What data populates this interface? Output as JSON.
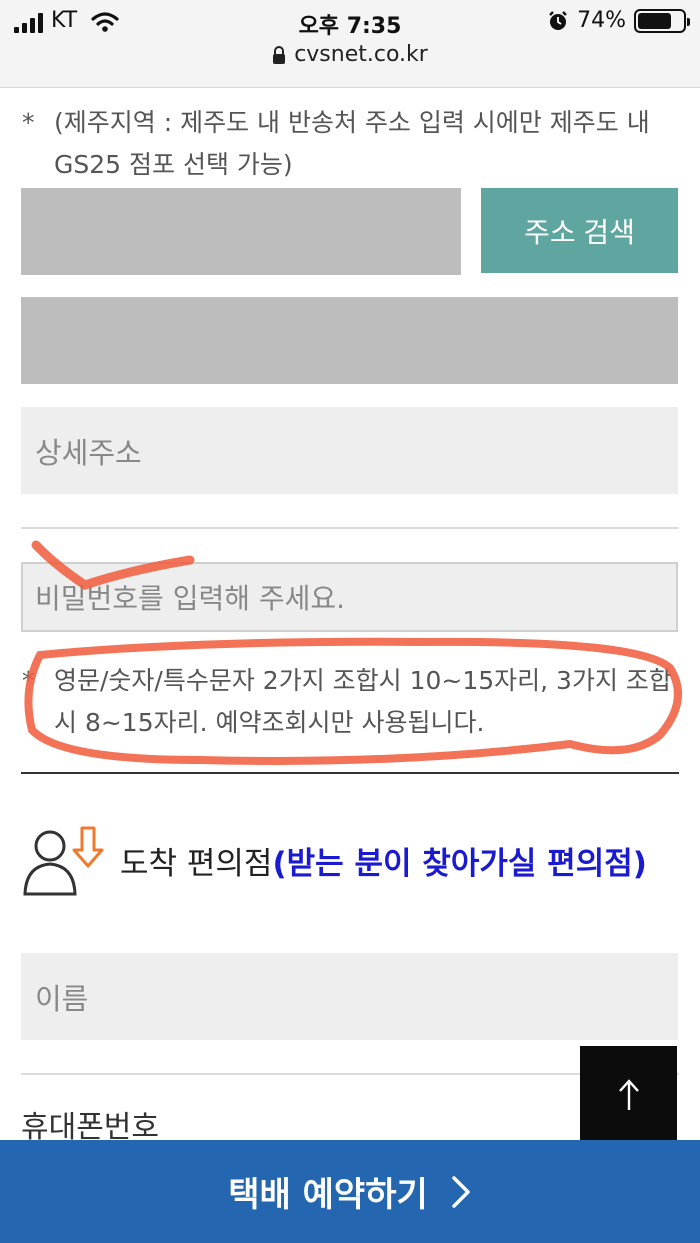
{
  "status": {
    "carrier": "KT",
    "time": "오후 7:35",
    "battery": "74%",
    "battery_level": 0.74,
    "url": "cvsnet.co.kr"
  },
  "form": {
    "jeju_note_star": "*",
    "jeju_note": "(제주지역 : 제주도 내 반송처 주소 입력 시에만 제주도 내 GS25 점포 선택 가능)",
    "search_button": "주소 검색",
    "detail_placeholder": "상세주소",
    "password_placeholder": "비밀번호를 입력해 주세요.",
    "password_note_star": "*",
    "password_note": "영문/숫자/특수문자 2가지 조합시 10~15자리, 3가지 조합시 8~15자리. 예약조회시만 사용됩니다."
  },
  "arrival": {
    "title": "도착 편의점",
    "subtitle": "(받는 분이 찾아가실 편의점)",
    "name_placeholder": "이름",
    "phone_label": "휴대폰번호"
  },
  "footer": {
    "top_icon": "arrow-up-icon",
    "reserve_button": "택배 예약하기",
    "reserve_icon": "chevron-right-icon"
  },
  "colors": {
    "search_button": "#5ea69f",
    "bottom_bar": "#2566b1",
    "subtitle_blue": "#1a1ad0",
    "annotation_red": "#f05a3a"
  }
}
